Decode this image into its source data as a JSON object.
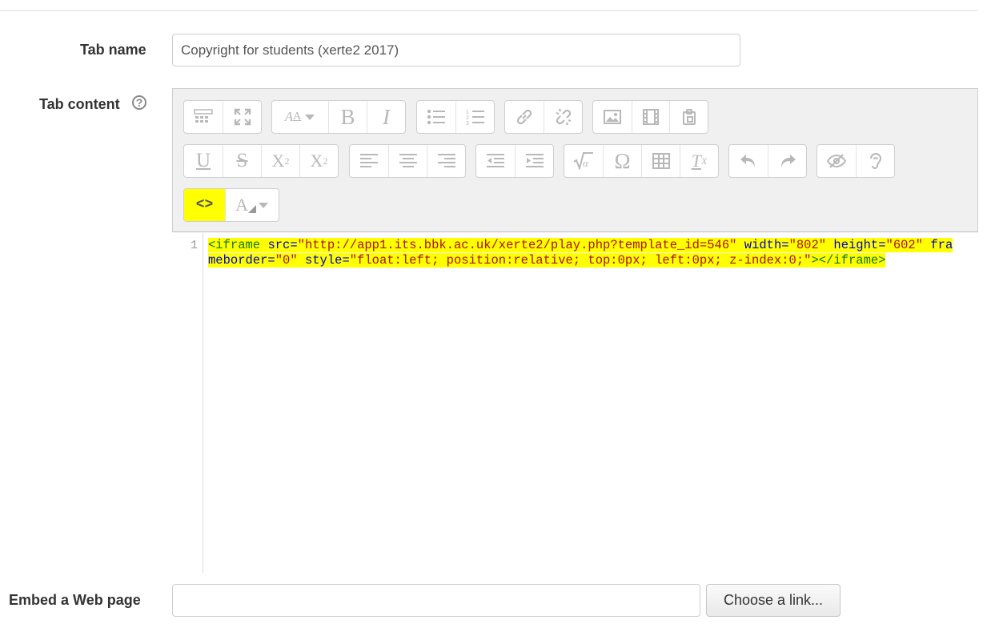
{
  "form": {
    "tab_name_label": "Tab name",
    "tab_name_value": "Copyright for students (xerte2 2017)",
    "tab_content_label": "Tab content",
    "help_icon_glyph": "?",
    "embed_label": "Embed a Web page",
    "embed_value": "",
    "choose_link_button": "Choose a link..."
  },
  "editor": {
    "toolbar_icons": {
      "row1": [
        "toolbar-toggle-icon",
        "fullscreen-icon",
        "font-size-icon",
        "bold-icon",
        "italic-icon",
        "unordered-list-icon",
        "ordered-list-icon",
        "link-icon",
        "unlink-icon",
        "image-icon",
        "media-icon",
        "manage-files-icon"
      ],
      "row2": [
        "underline-icon",
        "strikethrough-icon",
        "subscript-icon",
        "superscript-icon",
        "align-left-icon",
        "align-center-icon",
        "align-right-icon",
        "outdent-icon",
        "indent-icon",
        "equation-icon",
        "special-char-icon",
        "table-icon",
        "clear-formatting-icon",
        "undo-icon",
        "redo-icon",
        "accessibility-checker-icon",
        "screenreader-helper-icon"
      ],
      "row3": [
        "html-source-icon",
        "font-color-icon"
      ]
    },
    "glyphs": {
      "bold": "B",
      "italic": "I",
      "underline": "U",
      "strike": "S",
      "subscript": "X",
      "subscript_sub": "2",
      "superscript": "X",
      "superscript_sup": "2",
      "omega": "Ω",
      "clear": "T",
      "clear_sub": "X",
      "font_a": "A",
      "html_source": "<>"
    },
    "line_number": "1",
    "code": {
      "t1": "<iframe",
      "s1": " ",
      "a1": "src=",
      "v1": "\"http://app1.its.bbk.ac.uk/xerte2/play.php?template_id=546\"",
      "s2": " ",
      "a2": "width=",
      "v2": "\"802\"",
      "s3": " ",
      "a3": "height=",
      "v3": "\"602\"",
      "s4": " ",
      "a4": "frameborder=",
      "v4": "\"0\"",
      "s5": " ",
      "a5": "style=",
      "v5": "\"float:left; position:relative; top:0px; left:0px; z-index:0;\"",
      "t2": "></iframe>"
    },
    "highlight_color": "#ffff00"
  }
}
